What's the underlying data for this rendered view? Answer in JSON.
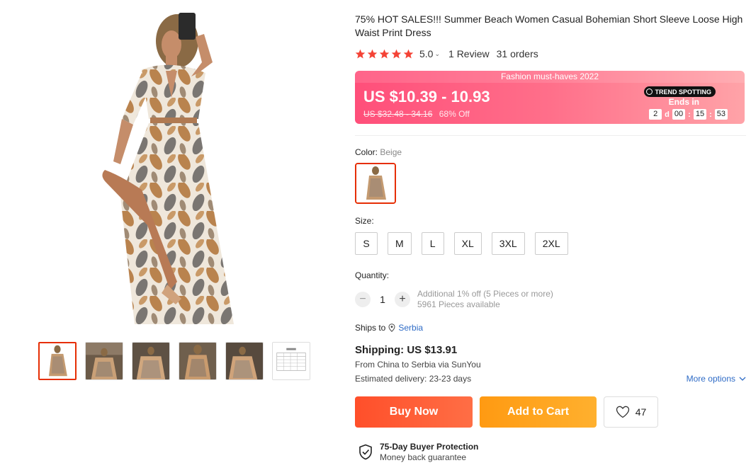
{
  "product": {
    "title": "75% HOT SALES!!! Summer Beach Women Casual Bohemian Short Sleeve Loose High Waist Print Dress",
    "rating": "5.0",
    "reviews": "1 Review",
    "orders": "31 orders"
  },
  "promo": {
    "banner": "Fashion must-haves 2022",
    "price": "US $10.39 - 10.93",
    "old_price": "US $32.48 - 34.16",
    "discount": "68% Off",
    "badge": "TREND SPOTTING",
    "ends_label": "Ends in",
    "countdown": {
      "days": "2",
      "days_unit": "d",
      "hours": "00",
      "minutes": "15",
      "seconds": "53",
      "sep": ":"
    }
  },
  "color": {
    "label": "Color: ",
    "value": "Beige"
  },
  "size": {
    "label": "Size:",
    "options": [
      "S",
      "M",
      "L",
      "XL",
      "3XL",
      "2XL"
    ]
  },
  "quantity": {
    "label": "Quantity:",
    "value": "1",
    "minus": "−",
    "plus": "+",
    "note1": "Additional 1% off (5 Pieces or more)",
    "note2": "5961 Pieces available"
  },
  "shipping": {
    "ships_to_label": "Ships to",
    "ships_to_country": "Serbia",
    "cost": "Shipping: US $13.91",
    "route": "From China to Serbia via SunYou",
    "estimate": "Estimated delivery: 23-23 days",
    "more_options": "More options"
  },
  "actions": {
    "buy_now": "Buy Now",
    "add_to_cart": "Add to Cart",
    "wishlist_count": "47"
  },
  "protection": {
    "title": "75-Day Buyer Protection",
    "subtitle": "Money back guarantee"
  },
  "colors": {
    "accent": "#e62e04",
    "star": "#f44336",
    "link": "#2e6bc6",
    "buy": "#ff4f2a",
    "cart": "#ff9a12"
  }
}
